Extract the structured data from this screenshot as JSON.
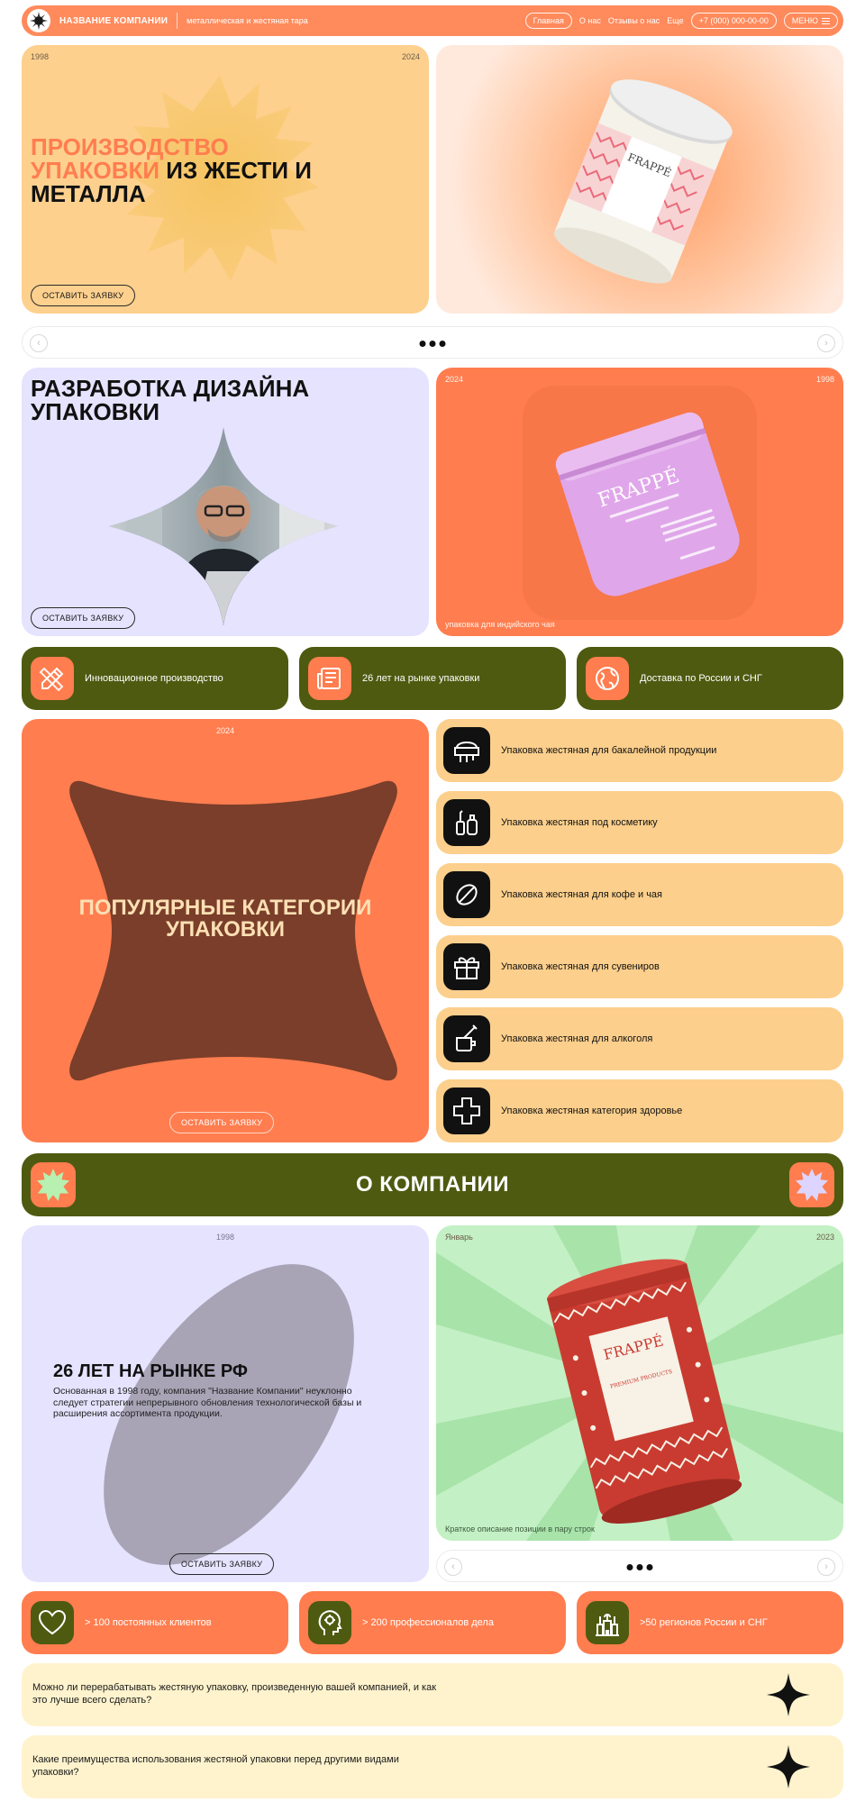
{
  "nav": {
    "company": "НАЗВАНИЕ КОМПАНИИ",
    "tagline": "металлическая и жестяная тара",
    "links": [
      "Главная",
      "О нас",
      "Отзывы о нас",
      "Еще"
    ],
    "phone": "+7 (000) 000-00-00",
    "menu": "МЕНЮ"
  },
  "hero": {
    "year_left": "1998",
    "year_right": "2024",
    "title_accent_1": "ПРОИЗВОДСТВО",
    "title_accent_2": "УПАКОВКИ",
    "title_rest_1": " ИЗ ЖЕСТИ И",
    "title_rest_2": "МЕТАЛЛА",
    "cta": "ОСТАВИТЬ ЗАЯВКУ",
    "product_brand": "FRAPPÉ"
  },
  "design": {
    "title_1": "РАЗРАБОТКА ДИЗАЙНА",
    "title_2": "УПАКОВКИ",
    "cta": "ОСТАВИТЬ ЗАЯВКУ",
    "year_left": "2024",
    "year_right": "1998",
    "caption": "упаковка для индийского чая",
    "product_brand": "FRAPPÉ"
  },
  "features": [
    {
      "label": "Инновационное производство",
      "icon": "pencil-ruler-icon"
    },
    {
      "label": "26 лет на рынке упаковки",
      "icon": "newspaper-icon"
    },
    {
      "label": "Доставка по России и СНГ",
      "icon": "globe-icon"
    }
  ],
  "categories": {
    "year": "2024",
    "title_1": "ПОПУЛЯРНЫЕ КАТЕГОРИИ",
    "title_2": "УПАКОВКИ",
    "cta": "ОСТАВИТЬ ЗАЯВКУ",
    "items": [
      {
        "label": "Упаковка жестяная для бакалейной продукции",
        "icon": "grocery-icon"
      },
      {
        "label": "Упаковка жестяная под косметику",
        "icon": "cosmetics-icon"
      },
      {
        "label": "Упаковка жестяная для кофе и чая",
        "icon": "coffee-bean-icon"
      },
      {
        "label": "Упаковка жестяная для сувениров",
        "icon": "gift-icon"
      },
      {
        "label": "Упаковка жестяная для алкоголя",
        "icon": "bottle-glass-icon"
      },
      {
        "label": "Упаковка жестяная категория здоровье",
        "icon": "medical-cross-icon"
      }
    ]
  },
  "about_banner": {
    "title": "О КОМПАНИИ"
  },
  "about": {
    "year": "1998",
    "title": "26 ЛЕТ НА РЫНКЕ РФ",
    "text": "Основанная в 1998 году, компания \"Название Компании\" неуклонно следует стратегии непрерывного обновления технологической базы и расширения ассортимента продукции.",
    "cta": "ОСТАВИТЬ ЗАЯВКУ",
    "month": "Январь",
    "year_right": "2023",
    "caption": "Краткое описание позиции в пару строк",
    "product_brand": "FRAPPÉ",
    "product_line": "PREMIUM PRODUCTS"
  },
  "stats": [
    {
      "label": "> 100 постоянных клиентов",
      "icon": "heart-icon"
    },
    {
      "label": "> 200 профессионалов дела",
      "icon": "head-gear-icon"
    },
    {
      "label": ">50 регионов России и СНГ",
      "icon": "kremlin-icon"
    }
  ],
  "faq": [
    "Можно ли перерабатывать жестяную упаковку, произведенную вашей компанией, и как это лучше всего сделать?",
    "Какие преимущества использования жестяной упаковки перед другими видами упаковки?"
  ],
  "colors": {
    "orange": "#ff7d4f",
    "cream": "#fccf8c",
    "olive": "#4e5a10",
    "lavender": "#e6e3ff",
    "mint": "#c3f0c4"
  }
}
